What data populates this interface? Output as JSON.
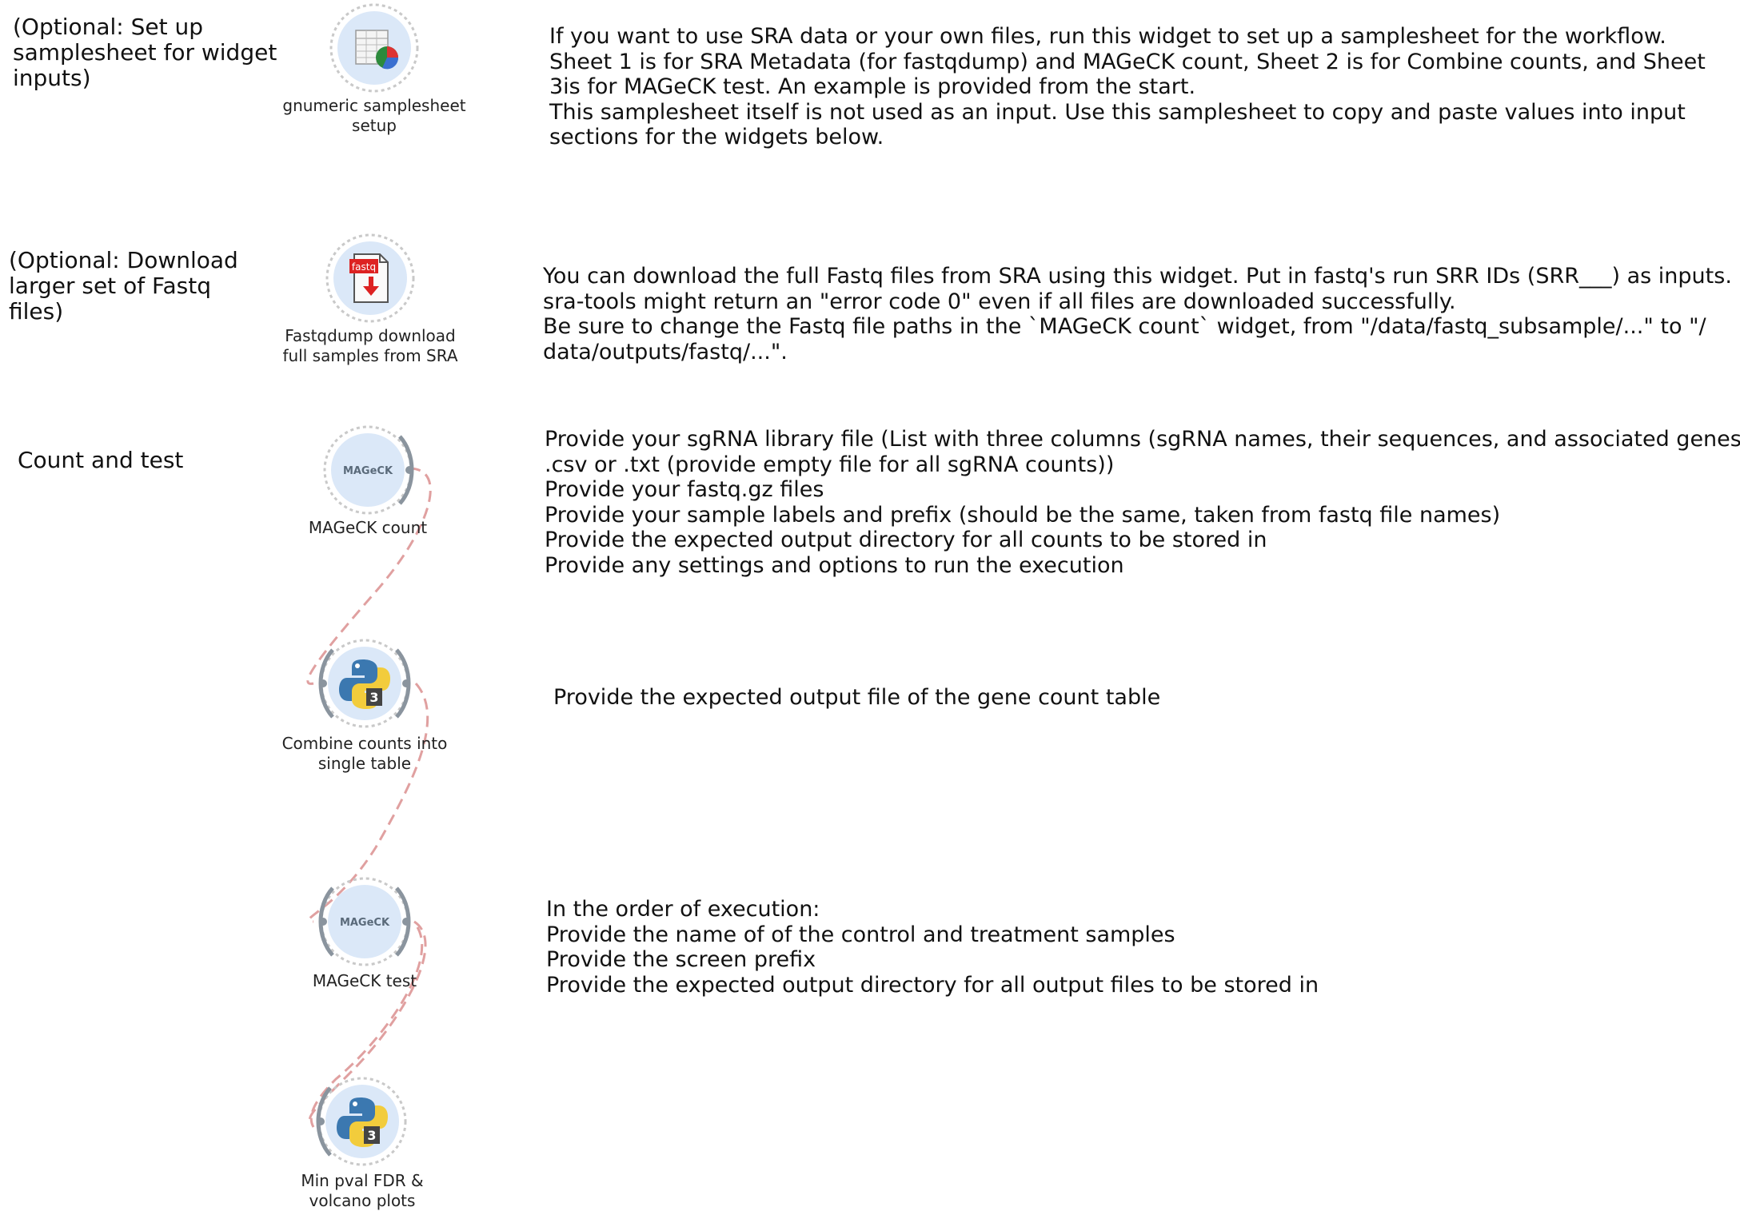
{
  "sections": {
    "setup_label": "(Optional: Set up\nsamplesheet for widget\ninputs)",
    "download_label": "(Optional: Download\nlarger set of Fastq\nfiles)",
    "count_label": "Count and test"
  },
  "widgets": {
    "gnumeric": {
      "caption": "gnumeric samplesheet\nsetup",
      "icon": "spreadsheet-chart-icon"
    },
    "fastqdump": {
      "caption": "Fastqdump download\nfull samples from SRA",
      "icon": "fastq-download-icon",
      "icon_text": "fastq"
    },
    "mageck_count": {
      "caption": "MAGeCK count",
      "icon": "mageck-icon",
      "icon_text": "MAGeCK"
    },
    "combine": {
      "caption": "Combine counts into\nsingle table",
      "icon": "python3-icon",
      "icon_text": "3"
    },
    "mageck_test": {
      "caption": "MAGeCK test",
      "icon": "mageck-icon",
      "icon_text": "MAGeCK"
    },
    "min_pval": {
      "caption": "Min pval FDR &\nvolcano plots",
      "icon": "python3-icon",
      "icon_text": "3"
    }
  },
  "notes": {
    "setup": "If you want to use SRA data or your own files, run this widget to set up a samplesheet for the workflow.\nSheet 1 is for SRA Metadata (for fastqdump) and MAGeCK count, Sheet 2 is for Combine counts, and Sheet\n3is for MAGeCK test. An example is provided from the start.\nThis samplesheet itself is not used as an input. Use this samplesheet to copy and paste values into input\nsections for the widgets below.",
    "download": "You can download the full Fastq files from SRA using this widget. Put in fastq's run SRR IDs (SRR___) as inputs.\nsra-tools might return an \"error code 0\" even if all files are downloaded successfully.\nBe sure to change the Fastq file paths in the `MAGeCK count` widget, from \"/data/fastq_subsample/...\" to \"/\ndata/outputs/fastq/...\".",
    "count": "Provide your sgRNA library file (List with three columns (sgRNA names, their sequences, and associated genes),\n.csv or .txt (provide empty file for all sgRNA counts))\nProvide your fastq.gz files\nProvide your sample labels and prefix (should be the same, taken from fastq file names)\nProvide the expected output directory for all counts to be stored in\nProvide any settings and options to run the execution",
    "combine": "Provide the expected output file of the gene count table",
    "test": "In the order of execution:\nProvide the name of of the control and treatment samples\nProvide the screen prefix\nProvide the expected output directory for all output files to be stored in"
  },
  "colors": {
    "widget_bg": "#dbe8f8",
    "widget_ring": "#c9c9c9",
    "link": "#e0a0a0",
    "connector": "#8a949e"
  }
}
